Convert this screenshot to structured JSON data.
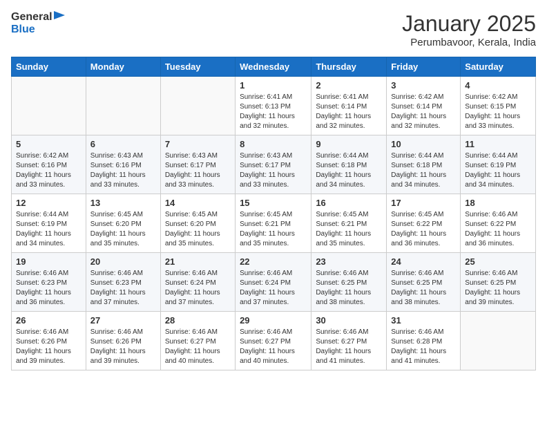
{
  "logo": {
    "text_general": "General",
    "text_blue": "Blue"
  },
  "title": "January 2025",
  "location": "Perumbavoor, Kerala, India",
  "days_of_week": [
    "Sunday",
    "Monday",
    "Tuesday",
    "Wednesday",
    "Thursday",
    "Friday",
    "Saturday"
  ],
  "weeks": [
    [
      {
        "day": "",
        "info": ""
      },
      {
        "day": "",
        "info": ""
      },
      {
        "day": "",
        "info": ""
      },
      {
        "day": "1",
        "info": "Sunrise: 6:41 AM\nSunset: 6:13 PM\nDaylight: 11 hours and 32 minutes."
      },
      {
        "day": "2",
        "info": "Sunrise: 6:41 AM\nSunset: 6:14 PM\nDaylight: 11 hours and 32 minutes."
      },
      {
        "day": "3",
        "info": "Sunrise: 6:42 AM\nSunset: 6:14 PM\nDaylight: 11 hours and 32 minutes."
      },
      {
        "day": "4",
        "info": "Sunrise: 6:42 AM\nSunset: 6:15 PM\nDaylight: 11 hours and 33 minutes."
      }
    ],
    [
      {
        "day": "5",
        "info": "Sunrise: 6:42 AM\nSunset: 6:16 PM\nDaylight: 11 hours and 33 minutes."
      },
      {
        "day": "6",
        "info": "Sunrise: 6:43 AM\nSunset: 6:16 PM\nDaylight: 11 hours and 33 minutes."
      },
      {
        "day": "7",
        "info": "Sunrise: 6:43 AM\nSunset: 6:17 PM\nDaylight: 11 hours and 33 minutes."
      },
      {
        "day": "8",
        "info": "Sunrise: 6:43 AM\nSunset: 6:17 PM\nDaylight: 11 hours and 33 minutes."
      },
      {
        "day": "9",
        "info": "Sunrise: 6:44 AM\nSunset: 6:18 PM\nDaylight: 11 hours and 34 minutes."
      },
      {
        "day": "10",
        "info": "Sunrise: 6:44 AM\nSunset: 6:18 PM\nDaylight: 11 hours and 34 minutes."
      },
      {
        "day": "11",
        "info": "Sunrise: 6:44 AM\nSunset: 6:19 PM\nDaylight: 11 hours and 34 minutes."
      }
    ],
    [
      {
        "day": "12",
        "info": "Sunrise: 6:44 AM\nSunset: 6:19 PM\nDaylight: 11 hours and 34 minutes."
      },
      {
        "day": "13",
        "info": "Sunrise: 6:45 AM\nSunset: 6:20 PM\nDaylight: 11 hours and 35 minutes."
      },
      {
        "day": "14",
        "info": "Sunrise: 6:45 AM\nSunset: 6:20 PM\nDaylight: 11 hours and 35 minutes."
      },
      {
        "day": "15",
        "info": "Sunrise: 6:45 AM\nSunset: 6:21 PM\nDaylight: 11 hours and 35 minutes."
      },
      {
        "day": "16",
        "info": "Sunrise: 6:45 AM\nSunset: 6:21 PM\nDaylight: 11 hours and 35 minutes."
      },
      {
        "day": "17",
        "info": "Sunrise: 6:45 AM\nSunset: 6:22 PM\nDaylight: 11 hours and 36 minutes."
      },
      {
        "day": "18",
        "info": "Sunrise: 6:46 AM\nSunset: 6:22 PM\nDaylight: 11 hours and 36 minutes."
      }
    ],
    [
      {
        "day": "19",
        "info": "Sunrise: 6:46 AM\nSunset: 6:23 PM\nDaylight: 11 hours and 36 minutes."
      },
      {
        "day": "20",
        "info": "Sunrise: 6:46 AM\nSunset: 6:23 PM\nDaylight: 11 hours and 37 minutes."
      },
      {
        "day": "21",
        "info": "Sunrise: 6:46 AM\nSunset: 6:24 PM\nDaylight: 11 hours and 37 minutes."
      },
      {
        "day": "22",
        "info": "Sunrise: 6:46 AM\nSunset: 6:24 PM\nDaylight: 11 hours and 37 minutes."
      },
      {
        "day": "23",
        "info": "Sunrise: 6:46 AM\nSunset: 6:25 PM\nDaylight: 11 hours and 38 minutes."
      },
      {
        "day": "24",
        "info": "Sunrise: 6:46 AM\nSunset: 6:25 PM\nDaylight: 11 hours and 38 minutes."
      },
      {
        "day": "25",
        "info": "Sunrise: 6:46 AM\nSunset: 6:25 PM\nDaylight: 11 hours and 39 minutes."
      }
    ],
    [
      {
        "day": "26",
        "info": "Sunrise: 6:46 AM\nSunset: 6:26 PM\nDaylight: 11 hours and 39 minutes."
      },
      {
        "day": "27",
        "info": "Sunrise: 6:46 AM\nSunset: 6:26 PM\nDaylight: 11 hours and 39 minutes."
      },
      {
        "day": "28",
        "info": "Sunrise: 6:46 AM\nSunset: 6:27 PM\nDaylight: 11 hours and 40 minutes."
      },
      {
        "day": "29",
        "info": "Sunrise: 6:46 AM\nSunset: 6:27 PM\nDaylight: 11 hours and 40 minutes."
      },
      {
        "day": "30",
        "info": "Sunrise: 6:46 AM\nSunset: 6:27 PM\nDaylight: 11 hours and 41 minutes."
      },
      {
        "day": "31",
        "info": "Sunrise: 6:46 AM\nSunset: 6:28 PM\nDaylight: 11 hours and 41 minutes."
      },
      {
        "day": "",
        "info": ""
      }
    ]
  ]
}
